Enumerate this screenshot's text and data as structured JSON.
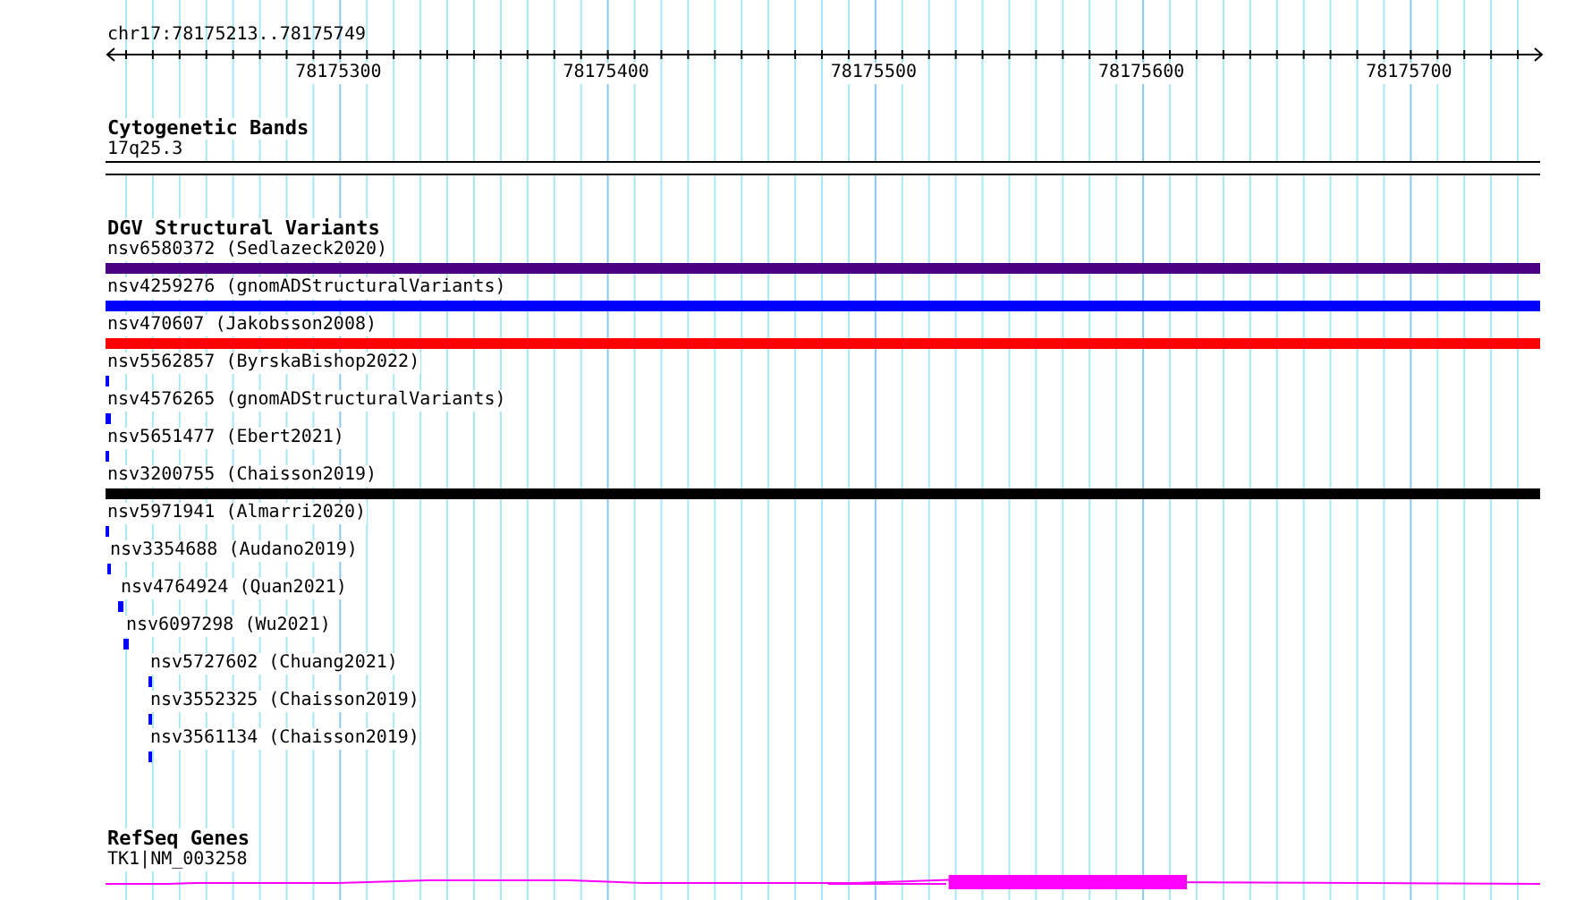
{
  "ruler": {
    "location": "chr17:78175213..78175749",
    "ticks": [
      "78175300",
      "78175400",
      "78175500",
      "78175600",
      "78175700"
    ]
  },
  "tracks": [
    {
      "kind": "cytoband",
      "title": "Cytogenetic Bands",
      "label": "17q25.3"
    },
    {
      "kind": "variants",
      "title": "DGV Structural Variants",
      "features": [
        {
          "label": "nsv6580372 (Sedlazeck2020)",
          "color": "#4b0082"
        },
        {
          "label": "nsv4259276 (gnomADStructuralVariants)",
          "color": "#0000ff"
        },
        {
          "label": "nsv470607 (Jakobsson2008)",
          "color": "#ff0000"
        },
        {
          "label": "nsv5562857 (ByrskaBishop2022)",
          "color": "#0000ff"
        },
        {
          "label": "nsv4576265 (gnomADStructuralVariants)",
          "color": "#0000ff"
        },
        {
          "label": "nsv5651477 (Ebert2021)",
          "color": "#0000ff"
        },
        {
          "label": "nsv3200755 (Chaisson2019)",
          "color": "#000000"
        },
        {
          "label": "nsv5971941 (Almarri2020)",
          "color": "#0000ff"
        },
        {
          "label": "nsv3354688 (Audano2019)",
          "color": "#0000ff"
        },
        {
          "label": "nsv4764924 (Quan2021)",
          "color": "#0000ff"
        },
        {
          "label": "nsv6097298 (Wu2021)",
          "color": "#0000ff"
        },
        {
          "label": "nsv5727602 (Chuang2021)",
          "color": "#0000ff"
        },
        {
          "label": "nsv3552325 (Chaisson2019)",
          "color": "#0000ff"
        },
        {
          "label": "nsv3561134 (Chaisson2019)",
          "color": "#0000ff"
        }
      ]
    },
    {
      "kind": "genes",
      "title": "RefSeq Genes",
      "label": "TK1|NM_003258"
    }
  ]
}
